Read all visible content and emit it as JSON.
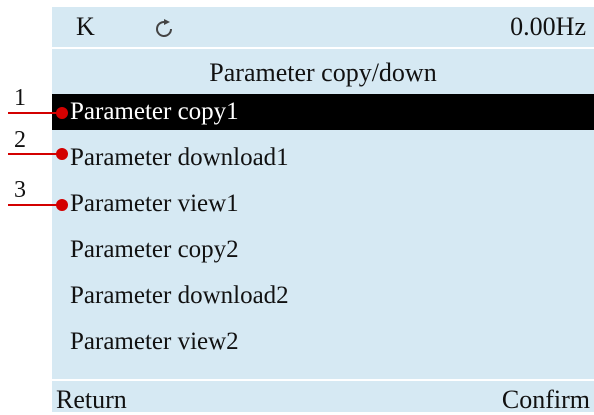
{
  "status_bar": {
    "mode": "K",
    "frequency": "0.00Hz",
    "icon": "refresh-icon"
  },
  "page": {
    "title": "Parameter copy/down"
  },
  "menu": {
    "items": [
      {
        "label": "Parameter copy1",
        "selected": true
      },
      {
        "label": "Parameter download1",
        "selected": false
      },
      {
        "label": "Parameter view1",
        "selected": false
      },
      {
        "label": "Parameter copy2",
        "selected": false
      },
      {
        "label": "Parameter download2",
        "selected": false
      },
      {
        "label": "Parameter view2",
        "selected": false
      }
    ]
  },
  "footer": {
    "left_label": "Return",
    "right_label": "Confirm"
  },
  "callouts": [
    "1",
    "2",
    "3"
  ],
  "colors": {
    "screen_background": "#d6e9f3",
    "selected_background": "#000000",
    "callout": "#d30000"
  }
}
